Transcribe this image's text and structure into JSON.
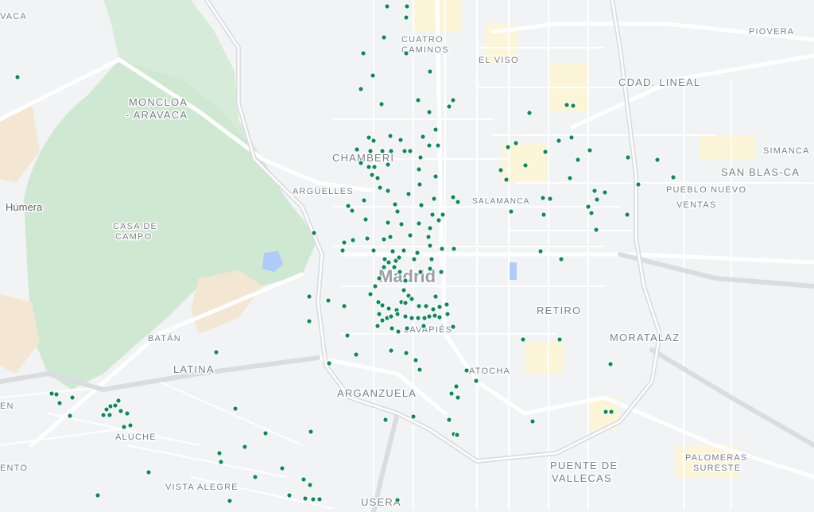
{
  "map": {
    "city": "Madrid",
    "marker_color": "#0f8a5a",
    "park_color": "#cfe8d2",
    "road_color": "#ffffff",
    "highway_color": "#dadce0",
    "labels": {
      "vaca": "VACA",
      "cuatro_caminos_1": "CUATRO",
      "cuatro_caminos_2": "CAMINOS",
      "el_viso": "EL VISO",
      "piovera": "PIOVERA",
      "cdad_lineal": "CDAD. LINEAL",
      "moncloa_1": "MONCLOA",
      "moncloa_2": "- ARAVACA",
      "chamberi": "CHAMBERÍ",
      "simancas": "SIMANCA",
      "san_blas": "SAN BLAS-CA",
      "arguelles": "ARGÜELLES",
      "salamanca": "SALAMANCA",
      "pueblo_nuevo": "PUEBLO NUEVO",
      "humera": "Húmera",
      "ventas": "VENTAS",
      "casa_campo_1": "CASA DE",
      "casa_campo_2": "CAMPO",
      "retiro": "RETIRO",
      "batan": "BATÁN",
      "lavapies": "LAVAPIÉS",
      "moratalaz": "MORATALAZ",
      "latina": "LATINA",
      "atocha": "ATOCHA",
      "arganzuela": "ARGANZUELA",
      "en": "EN",
      "aluche": "ALUCHE",
      "ento": "ENTO",
      "puente_1": "PUENTE DE",
      "puente_2": "VALLECAS",
      "palomeras_1": "PALOMERAS",
      "palomeras_2": "SURESTE",
      "vista_alegre": "VISTA ALEGRE",
      "usera": "USERA"
    }
  }
}
